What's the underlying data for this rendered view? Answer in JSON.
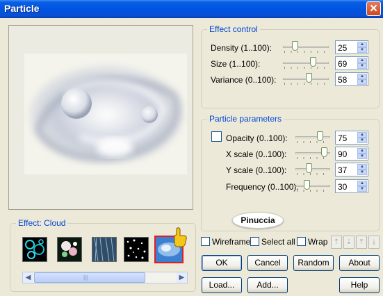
{
  "window": {
    "title": "Particle",
    "close_glyph": "✕"
  },
  "effect_group": {
    "legend": "Effect: Cloud"
  },
  "thumbnails": [
    {
      "name": "bubbles",
      "icon": "bubbles-thumb"
    },
    {
      "name": "sparkles",
      "icon": "sparkles-thumb"
    },
    {
      "name": "rain",
      "icon": "rain-thumb"
    },
    {
      "name": "snow",
      "icon": "snow-thumb"
    },
    {
      "name": "cloud",
      "icon": "cloud-thumb",
      "selected": true
    }
  ],
  "scrollbar": {
    "left_arrow": "◀",
    "right_arrow": "▶",
    "grip": "|||"
  },
  "effect_control": {
    "legend": "Effect control",
    "rows": [
      {
        "label": "Density (1..100):",
        "value": "25",
        "level": 0.24
      },
      {
        "label": "Size (1..100):",
        "value": "69",
        "level": 0.69
      },
      {
        "label": "Variance (0..100):",
        "value": "58",
        "level": 0.58
      }
    ]
  },
  "particle_parameters": {
    "legend": "Particle parameters",
    "rows": [
      {
        "label": "Opacity (0..100):",
        "value": "75",
        "level": 0.75
      },
      {
        "label": "X scale (0..100):",
        "value": "90",
        "level": 0.9
      },
      {
        "label": "Y scale (0..100):",
        "value": "37",
        "level": 0.37
      },
      {
        "label": "Frequency (0..100):",
        "value": "30",
        "level": 0.3
      }
    ],
    "opacity_checked": false
  },
  "logo_text": "Pinuccia",
  "options": {
    "wireframe": "Wireframe",
    "select_all": "Select all",
    "wrap": "Wrap"
  },
  "order_buttons": [
    "⇡",
    "⇣",
    "⤒",
    "⤓"
  ],
  "buttons": {
    "ok": "OK",
    "cancel": "Cancel",
    "random": "Random",
    "about": "About",
    "load": "Load...",
    "add": "Add...",
    "help": "Help"
  },
  "colors": {
    "title_bar": "#0054e3",
    "legend_text": "#0046d5",
    "dialog_bg": "#ece9d8",
    "selected_border": "#e02020"
  }
}
